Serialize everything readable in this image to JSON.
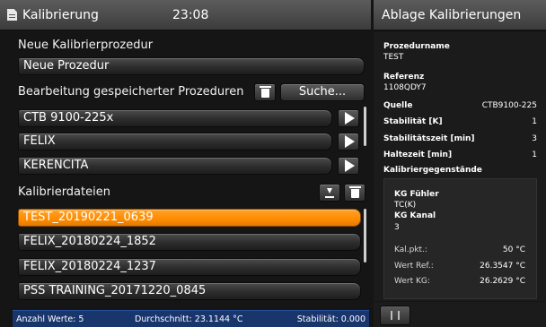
{
  "header": {
    "title": "Kalibrierung",
    "time": "23:08",
    "right_title": "Ablage Kalibrierungen"
  },
  "new_procedure": {
    "label": "Neue Kalibrierprozedur",
    "value": "Neue Prozedur"
  },
  "saved": {
    "label": "Bearbeitung gespeicherter Prozeduren",
    "search_label": "Suche...",
    "items": [
      "CTB 9100-225x",
      "FELIX",
      "KERENCITA"
    ]
  },
  "files": {
    "label": "Kalibrierdateien",
    "items": [
      "TEST_20190221_0639",
      "FELIX_20180224_1852",
      "FELIX_20180224_1237",
      "PSS TRAINING_20171220_0845"
    ],
    "selected_index": 0
  },
  "status": {
    "count": "Anzahl Werte: 5",
    "avg": "Durchschnitt: 23.1144 °C",
    "stab": "Stabilität: 0.000"
  },
  "details": {
    "name_label": "Prozedurname",
    "name": "TEST",
    "ref_label": "Referenz",
    "ref": "1108QDY7",
    "source_label": "Quelle",
    "source": "CTB9100-225",
    "stability_label": "Stabilität [K]",
    "stability": "1",
    "stabtime_label": "Stabilitätszeit [min]",
    "stabtime": "3",
    "hold_label": "Haltezeit [min]",
    "hold": "1",
    "items_label": "Kalibriergegenstände",
    "kg": {
      "sensor_label": "KG Fühler",
      "sensor": "TC(K)",
      "channel_label": "KG Kanal",
      "channel": "3",
      "point_label": "Kal.pkt.:",
      "point": "50 °C",
      "ref_label": "Wert Ref.:",
      "ref": "26.3547 °C",
      "kg_label": "Wert KG:",
      "kg": "26.2629 °C"
    }
  }
}
